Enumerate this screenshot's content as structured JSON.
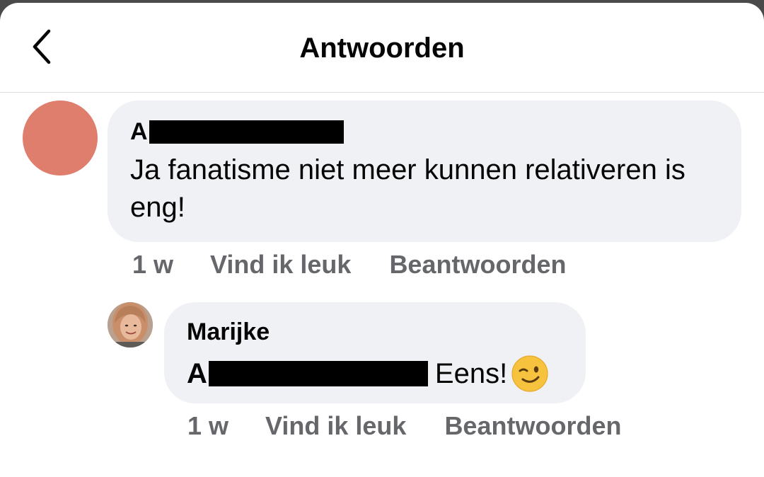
{
  "header": {
    "title": "Antwoorden",
    "back_icon": "chevron-left-icon"
  },
  "comments": [
    {
      "author_initial": "A",
      "author_redacted": true,
      "avatar_color": "#e07e6e",
      "text": "Ja fanatisme niet meer kunnen relativeren is eng!",
      "time": "1 w",
      "like_label": "Vind ik leuk",
      "reply_label": "Beantwoorden"
    },
    {
      "author": "Marijke",
      "avatar": "profile-photo",
      "mention_initial": "A",
      "mention_redacted": true,
      "text": "Eens!",
      "emoji": "winking-face-icon",
      "time": "1 w",
      "like_label": "Vind ik leuk",
      "reply_label": "Beantwoorden"
    }
  ],
  "colors": {
    "bubble": "#f0f1f5",
    "secondary_text": "#65676b",
    "divider": "#dadde1"
  }
}
